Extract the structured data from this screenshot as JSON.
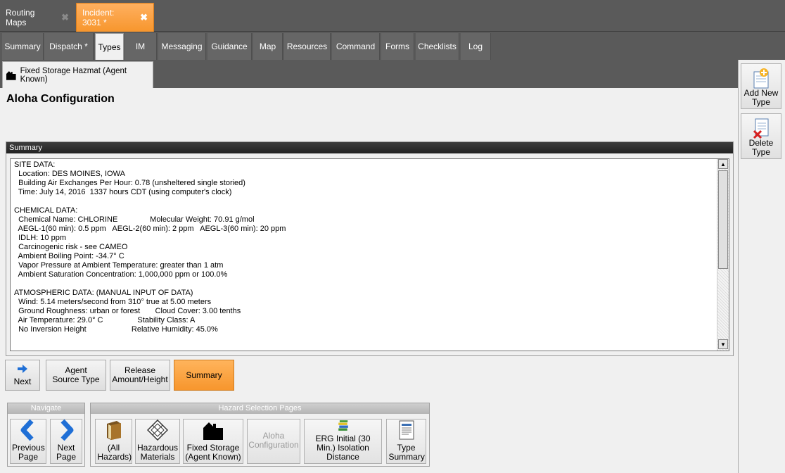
{
  "doc_tabs": [
    {
      "label": "Routing Maps",
      "close": "✖"
    },
    {
      "label": "Incident: 3031 *",
      "close": "✖"
    }
  ],
  "nav_tabs": [
    "Summary",
    "Dispatch *",
    "Types",
    "IM",
    "Messaging",
    "Guidance",
    "Map",
    "Resources",
    "Command",
    "Forms",
    "Checklists",
    "Log"
  ],
  "type_tab": {
    "label": "Fixed Storage Hazmat (Agent Known)",
    "icon": "house-icon"
  },
  "page_title": "Aloha Configuration",
  "summary": {
    "header": "Summary",
    "text": "SITE DATA:\n  Location: DES MOINES, IOWA\n  Building Air Exchanges Per Hour: 0.78 (unsheltered single storied)\n  Time: July 14, 2016  1337 hours CDT (using computer's clock)\n\nCHEMICAL DATA:\n  Chemical Name: CHLORINE               Molecular Weight: 70.91 g/mol\n  AEGL-1(60 min): 0.5 ppm   AEGL-2(60 min): 2 ppm   AEGL-3(60 min): 20 ppm\n  IDLH: 10 ppm\n  Carcinogenic risk - see CAMEO\n  Ambient Boiling Point: -34.7° C\n  Vapor Pressure at Ambient Temperature: greater than 1 atm\n  Ambient Saturation Concentration: 1,000,000 ppm or 100.0%\n\nATMOSPHERIC DATA: (MANUAL INPUT OF DATA)\n  Wind: 5.14 meters/second from 310° true at 5.00 meters\n  Ground Roughness: urban or forest       Cloud Cover: 3.00 tenths\n  Air Temperature: 29.0° C                Stability Class: A\n  No Inversion Height                     Relative Humidity: 45.0%"
  },
  "wizard": {
    "next": "Next",
    "agent_source": "Agent Source Type",
    "release": "Release Amount/Height",
    "summary": "Summary"
  },
  "navigate": {
    "header": "Navigate",
    "previous": "Previous Page",
    "next": "Next Page"
  },
  "hazard": {
    "header": "Hazard Selection Pages",
    "all": "(All Hazards)",
    "materials": "Hazardous Materials",
    "fixed": "Fixed Storage (Agent Known)",
    "aloha": "Aloha Configuration",
    "erg": "ERG Initial (30 Min.) Isolation Distance",
    "type_summary": "Type Summary"
  },
  "side": {
    "add": "Add New Type",
    "delete": "Delete Type"
  },
  "colors": {
    "accent_orange": "#f7962d",
    "dark_bg": "#5a5a5a",
    "blue_arrow": "#1f6fd6"
  }
}
